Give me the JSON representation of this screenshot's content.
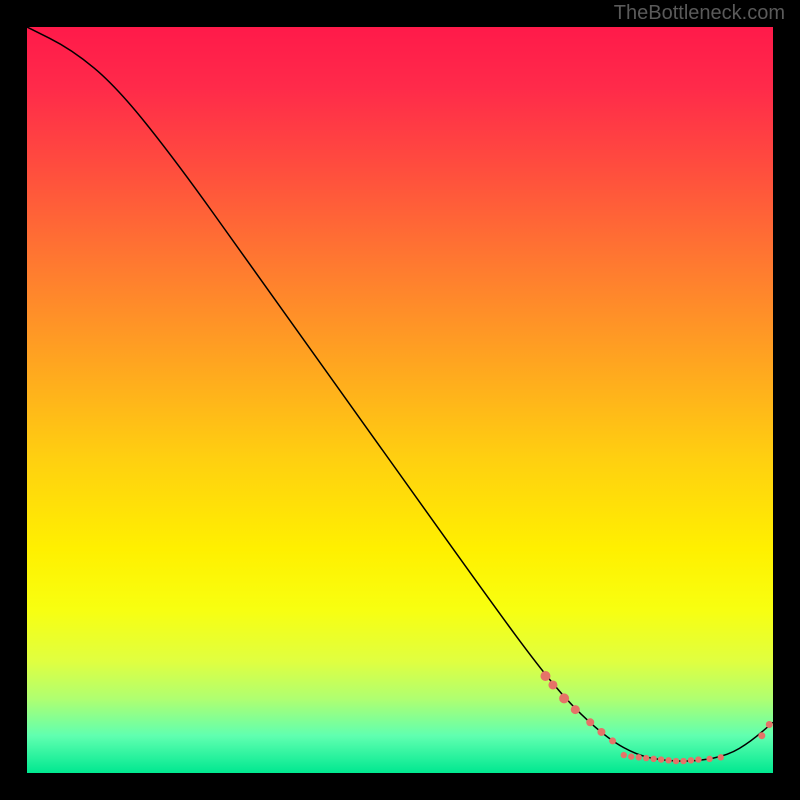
{
  "watermark": "TheBottleneck.com",
  "chart_data": {
    "type": "line",
    "title": "",
    "xlabel": "",
    "ylabel": "",
    "xlim": [
      0,
      100
    ],
    "ylim": [
      0,
      100
    ],
    "curve": [
      {
        "x": 0,
        "y": 100
      },
      {
        "x": 6,
        "y": 97
      },
      {
        "x": 12,
        "y": 92
      },
      {
        "x": 20,
        "y": 82
      },
      {
        "x": 30,
        "y": 68
      },
      {
        "x": 40,
        "y": 54
      },
      {
        "x": 50,
        "y": 40
      },
      {
        "x": 60,
        "y": 26
      },
      {
        "x": 68,
        "y": 15
      },
      {
        "x": 73,
        "y": 9
      },
      {
        "x": 78,
        "y": 4.5
      },
      {
        "x": 82,
        "y": 2.3
      },
      {
        "x": 86,
        "y": 1.6
      },
      {
        "x": 90,
        "y": 1.6
      },
      {
        "x": 94,
        "y": 2.4
      },
      {
        "x": 97,
        "y": 4.2
      },
      {
        "x": 100,
        "y": 6.8
      }
    ],
    "dots": [
      {
        "x": 69.5,
        "y": 13.0,
        "r": 5.0
      },
      {
        "x": 70.5,
        "y": 11.8,
        "r": 4.5
      },
      {
        "x": 72.0,
        "y": 10.0,
        "r": 5.0
      },
      {
        "x": 73.5,
        "y": 8.5,
        "r": 4.5
      },
      {
        "x": 75.5,
        "y": 6.8,
        "r": 4.0
      },
      {
        "x": 77.0,
        "y": 5.5,
        "r": 4.0
      },
      {
        "x": 78.5,
        "y": 4.3,
        "r": 3.5
      },
      {
        "x": 80.0,
        "y": 2.4,
        "r": 3.2
      },
      {
        "x": 81.0,
        "y": 2.2,
        "r": 3.2
      },
      {
        "x": 82.0,
        "y": 2.1,
        "r": 3.2
      },
      {
        "x": 83.0,
        "y": 2.0,
        "r": 3.2
      },
      {
        "x": 84.0,
        "y": 1.9,
        "r": 3.2
      },
      {
        "x": 85.0,
        "y": 1.8,
        "r": 3.2
      },
      {
        "x": 86.0,
        "y": 1.7,
        "r": 3.2
      },
      {
        "x": 87.0,
        "y": 1.6,
        "r": 3.2
      },
      {
        "x": 88.0,
        "y": 1.6,
        "r": 3.2
      },
      {
        "x": 89.0,
        "y": 1.7,
        "r": 3.2
      },
      {
        "x": 90.0,
        "y": 1.8,
        "r": 3.2
      },
      {
        "x": 91.5,
        "y": 1.9,
        "r": 3.2
      },
      {
        "x": 93.0,
        "y": 2.1,
        "r": 3.2
      },
      {
        "x": 98.5,
        "y": 5.0,
        "r": 3.5
      },
      {
        "x": 99.5,
        "y": 6.5,
        "r": 3.5
      }
    ]
  }
}
